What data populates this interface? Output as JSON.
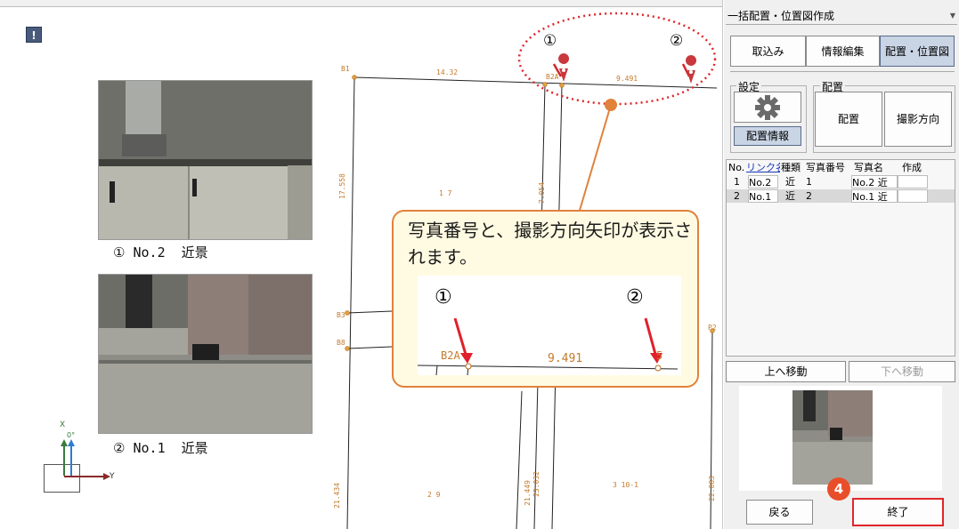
{
  "panel": {
    "title": "一括配置・位置図作成",
    "tabs": [
      "取込み",
      "情報編集",
      "配置・位置図"
    ],
    "settings_group": "設定",
    "placement_group": "配置",
    "placement_info": "配置情報",
    "place_button": "配置",
    "direction_button": "撮影方向",
    "table": {
      "headers": [
        "No.",
        "リンク名",
        "種類",
        "写真番号",
        "写真名",
        "作成"
      ],
      "rows": [
        [
          "1",
          "No.2",
          "近",
          "1",
          "No.2 近",
          ""
        ],
        [
          "2",
          "No.1",
          "近",
          "2",
          "No.1 近",
          ""
        ]
      ]
    },
    "move_up": "上へ移動",
    "move_down": "下へ移動",
    "back": "戻る",
    "finish": "終了"
  },
  "canvas": {
    "photo1_caption": "① No.2  近景",
    "photo2_caption": "② No.1  近景",
    "marker1": "①",
    "marker2": "②",
    "axis_x": "X",
    "axis_angle": "0°",
    "axis_y": "Y",
    "map_labels": {
      "b1": "B1",
      "d1": "14.32",
      "b2": "B2A",
      "d2": "9.491",
      "b3": "B3",
      "b8": "B8",
      "p2": "P2",
      "v1": "17.558",
      "n17": "1 7",
      "v2": "7.054",
      "v3": "21.434",
      "n29": "2 9",
      "v4": "21.449",
      "v5": "23.032",
      "n310": "3 10-1",
      "v6": "22.083"
    }
  },
  "callout": {
    "text": "写真番号と、撮影方向矢印が表示されます。",
    "inset_marker1": "①",
    "inset_marker2": "②",
    "inset_b2": "B2A",
    "inset_distance": "9.491",
    "inset_end": "5"
  },
  "badge_step": "4",
  "colors": {
    "accent": "#e94e2a",
    "callout_border": "#e1823c",
    "callout_bg": "#fffbe2",
    "map_label": "#c47a2a",
    "active_tab": "#c9d4e4"
  }
}
